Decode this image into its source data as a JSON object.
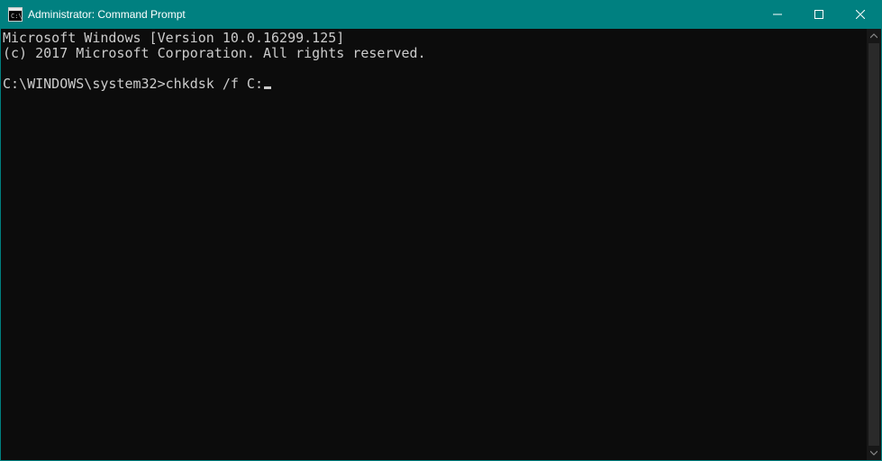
{
  "window": {
    "title": "Administrator: Command Prompt",
    "controls": {
      "minimize_label": "Minimize",
      "maximize_label": "Maximize",
      "close_label": "Close"
    }
  },
  "console": {
    "lines": [
      "Microsoft Windows [Version 10.0.16299.125]",
      "(c) 2017 Microsoft Corporation. All rights reserved.",
      ""
    ],
    "prompt": "C:\\WINDOWS\\system32>",
    "command": "chkdsk /f C:"
  }
}
